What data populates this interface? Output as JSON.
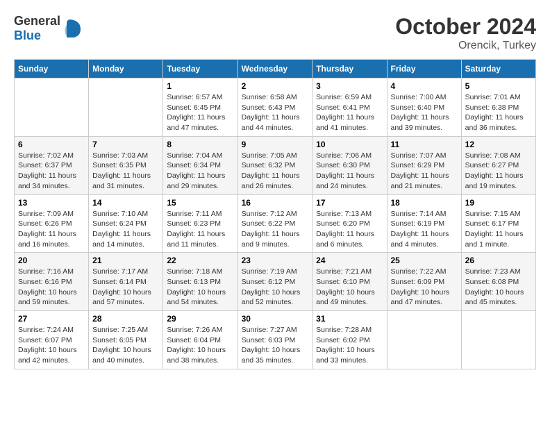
{
  "header": {
    "logo_general": "General",
    "logo_blue": "Blue",
    "month": "October 2024",
    "location": "Orencik, Turkey"
  },
  "weekdays": [
    "Sunday",
    "Monday",
    "Tuesday",
    "Wednesday",
    "Thursday",
    "Friday",
    "Saturday"
  ],
  "weeks": [
    [
      null,
      null,
      {
        "day": "1",
        "sunrise": "Sunrise: 6:57 AM",
        "sunset": "Sunset: 6:45 PM",
        "daylight": "Daylight: 11 hours and 47 minutes."
      },
      {
        "day": "2",
        "sunrise": "Sunrise: 6:58 AM",
        "sunset": "Sunset: 6:43 PM",
        "daylight": "Daylight: 11 hours and 44 minutes."
      },
      {
        "day": "3",
        "sunrise": "Sunrise: 6:59 AM",
        "sunset": "Sunset: 6:41 PM",
        "daylight": "Daylight: 11 hours and 41 minutes."
      },
      {
        "day": "4",
        "sunrise": "Sunrise: 7:00 AM",
        "sunset": "Sunset: 6:40 PM",
        "daylight": "Daylight: 11 hours and 39 minutes."
      },
      {
        "day": "5",
        "sunrise": "Sunrise: 7:01 AM",
        "sunset": "Sunset: 6:38 PM",
        "daylight": "Daylight: 11 hours and 36 minutes."
      }
    ],
    [
      {
        "day": "6",
        "sunrise": "Sunrise: 7:02 AM",
        "sunset": "Sunset: 6:37 PM",
        "daylight": "Daylight: 11 hours and 34 minutes."
      },
      {
        "day": "7",
        "sunrise": "Sunrise: 7:03 AM",
        "sunset": "Sunset: 6:35 PM",
        "daylight": "Daylight: 11 hours and 31 minutes."
      },
      {
        "day": "8",
        "sunrise": "Sunrise: 7:04 AM",
        "sunset": "Sunset: 6:34 PM",
        "daylight": "Daylight: 11 hours and 29 minutes."
      },
      {
        "day": "9",
        "sunrise": "Sunrise: 7:05 AM",
        "sunset": "Sunset: 6:32 PM",
        "daylight": "Daylight: 11 hours and 26 minutes."
      },
      {
        "day": "10",
        "sunrise": "Sunrise: 7:06 AM",
        "sunset": "Sunset: 6:30 PM",
        "daylight": "Daylight: 11 hours and 24 minutes."
      },
      {
        "day": "11",
        "sunrise": "Sunrise: 7:07 AM",
        "sunset": "Sunset: 6:29 PM",
        "daylight": "Daylight: 11 hours and 21 minutes."
      },
      {
        "day": "12",
        "sunrise": "Sunrise: 7:08 AM",
        "sunset": "Sunset: 6:27 PM",
        "daylight": "Daylight: 11 hours and 19 minutes."
      }
    ],
    [
      {
        "day": "13",
        "sunrise": "Sunrise: 7:09 AM",
        "sunset": "Sunset: 6:26 PM",
        "daylight": "Daylight: 11 hours and 16 minutes."
      },
      {
        "day": "14",
        "sunrise": "Sunrise: 7:10 AM",
        "sunset": "Sunset: 6:24 PM",
        "daylight": "Daylight: 11 hours and 14 minutes."
      },
      {
        "day": "15",
        "sunrise": "Sunrise: 7:11 AM",
        "sunset": "Sunset: 6:23 PM",
        "daylight": "Daylight: 11 hours and 11 minutes."
      },
      {
        "day": "16",
        "sunrise": "Sunrise: 7:12 AM",
        "sunset": "Sunset: 6:22 PM",
        "daylight": "Daylight: 11 hours and 9 minutes."
      },
      {
        "day": "17",
        "sunrise": "Sunrise: 7:13 AM",
        "sunset": "Sunset: 6:20 PM",
        "daylight": "Daylight: 11 hours and 6 minutes."
      },
      {
        "day": "18",
        "sunrise": "Sunrise: 7:14 AM",
        "sunset": "Sunset: 6:19 PM",
        "daylight": "Daylight: 11 hours and 4 minutes."
      },
      {
        "day": "19",
        "sunrise": "Sunrise: 7:15 AM",
        "sunset": "Sunset: 6:17 PM",
        "daylight": "Daylight: 11 hours and 1 minute."
      }
    ],
    [
      {
        "day": "20",
        "sunrise": "Sunrise: 7:16 AM",
        "sunset": "Sunset: 6:16 PM",
        "daylight": "Daylight: 10 hours and 59 minutes."
      },
      {
        "day": "21",
        "sunrise": "Sunrise: 7:17 AM",
        "sunset": "Sunset: 6:14 PM",
        "daylight": "Daylight: 10 hours and 57 minutes."
      },
      {
        "day": "22",
        "sunrise": "Sunrise: 7:18 AM",
        "sunset": "Sunset: 6:13 PM",
        "daylight": "Daylight: 10 hours and 54 minutes."
      },
      {
        "day": "23",
        "sunrise": "Sunrise: 7:19 AM",
        "sunset": "Sunset: 6:12 PM",
        "daylight": "Daylight: 10 hours and 52 minutes."
      },
      {
        "day": "24",
        "sunrise": "Sunrise: 7:21 AM",
        "sunset": "Sunset: 6:10 PM",
        "daylight": "Daylight: 10 hours and 49 minutes."
      },
      {
        "day": "25",
        "sunrise": "Sunrise: 7:22 AM",
        "sunset": "Sunset: 6:09 PM",
        "daylight": "Daylight: 10 hours and 47 minutes."
      },
      {
        "day": "26",
        "sunrise": "Sunrise: 7:23 AM",
        "sunset": "Sunset: 6:08 PM",
        "daylight": "Daylight: 10 hours and 45 minutes."
      }
    ],
    [
      {
        "day": "27",
        "sunrise": "Sunrise: 7:24 AM",
        "sunset": "Sunset: 6:07 PM",
        "daylight": "Daylight: 10 hours and 42 minutes."
      },
      {
        "day": "28",
        "sunrise": "Sunrise: 7:25 AM",
        "sunset": "Sunset: 6:05 PM",
        "daylight": "Daylight: 10 hours and 40 minutes."
      },
      {
        "day": "29",
        "sunrise": "Sunrise: 7:26 AM",
        "sunset": "Sunset: 6:04 PM",
        "daylight": "Daylight: 10 hours and 38 minutes."
      },
      {
        "day": "30",
        "sunrise": "Sunrise: 7:27 AM",
        "sunset": "Sunset: 6:03 PM",
        "daylight": "Daylight: 10 hours and 35 minutes."
      },
      {
        "day": "31",
        "sunrise": "Sunrise: 7:28 AM",
        "sunset": "Sunset: 6:02 PM",
        "daylight": "Daylight: 10 hours and 33 minutes."
      },
      null,
      null
    ]
  ]
}
